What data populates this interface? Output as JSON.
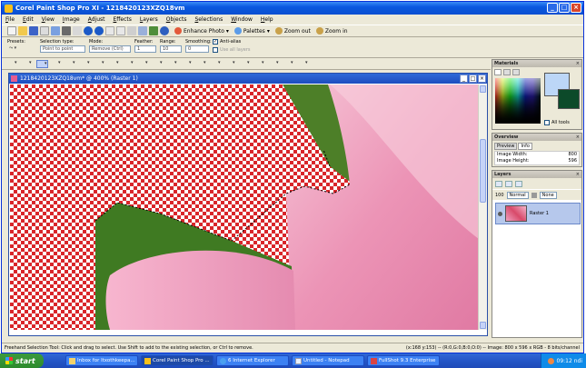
{
  "app": {
    "title": "Corel Paint Shop Pro XI - 1218420123XZQ18vm"
  },
  "menu": [
    "File",
    "Edit",
    "View",
    "Image",
    "Adjust",
    "Effects",
    "Layers",
    "Objects",
    "Selections",
    "Window",
    "Help"
  ],
  "toolbar": {
    "enhance_photo": "Enhance Photo",
    "palettes": "Palettes",
    "zoom_out": "Zoom out",
    "zoom_in": "Zoom in"
  },
  "options": {
    "presets_label": "Presets:",
    "selection_type_label": "Selection type:",
    "selection_type_value": "Point to point",
    "mode_label": "Mode:",
    "mode_value": "Remove (Ctrl)",
    "feather_label": "Feather:",
    "feather_value": "1",
    "range_label": "Range:",
    "range_value": "10",
    "smoothing_label": "Smoothing:",
    "smoothing_value": "0",
    "antialias_label": "Anti-alias",
    "use_all_layers_label": "Use all layers"
  },
  "document": {
    "title": "1218420123XZQ18vm* @ 400% (Raster 1)"
  },
  "panels": {
    "materials": "Materials",
    "all_tools": "All tools",
    "overview": "Overview",
    "preview_tab": "Preview",
    "info_tab": "Info",
    "image_width_label": "Image Width:",
    "image_width_value": "800",
    "image_height_label": "Image Height:",
    "image_height_value": "596",
    "layers": "Layers",
    "opacity": "100",
    "blend_mode": "Normal",
    "layer_mask": "None",
    "layer_name": "Raster 1"
  },
  "status": {
    "left": "Freehand Selection Tool: Click and drag to select. Use Shift to add to the existing selection, or Ctrl to remove.",
    "right": "(x:168 y:153) -- (R:0,G:0,B:0,O:0) -- Image: 800 x 596 x RGB - 8 bits/channel"
  },
  "taskbar": {
    "start": "start",
    "items": [
      {
        "label": "Inbox for ltxothkeepa...",
        "active": false
      },
      {
        "label": "Corel Paint Shop Pro ...",
        "active": true
      },
      {
        "label": "6 Internet Explorer",
        "active": false
      },
      {
        "label": "Untitled - Notepad",
        "active": false
      },
      {
        "label": "FullShot 9.3 Enterprise",
        "active": false
      }
    ],
    "clock": "09:12 ndi"
  },
  "colors": {
    "titlebar": "#0a58e0",
    "checker_red": "#d9262a",
    "petal": "#f2a3c1",
    "leaf": "#5b8a2c"
  }
}
